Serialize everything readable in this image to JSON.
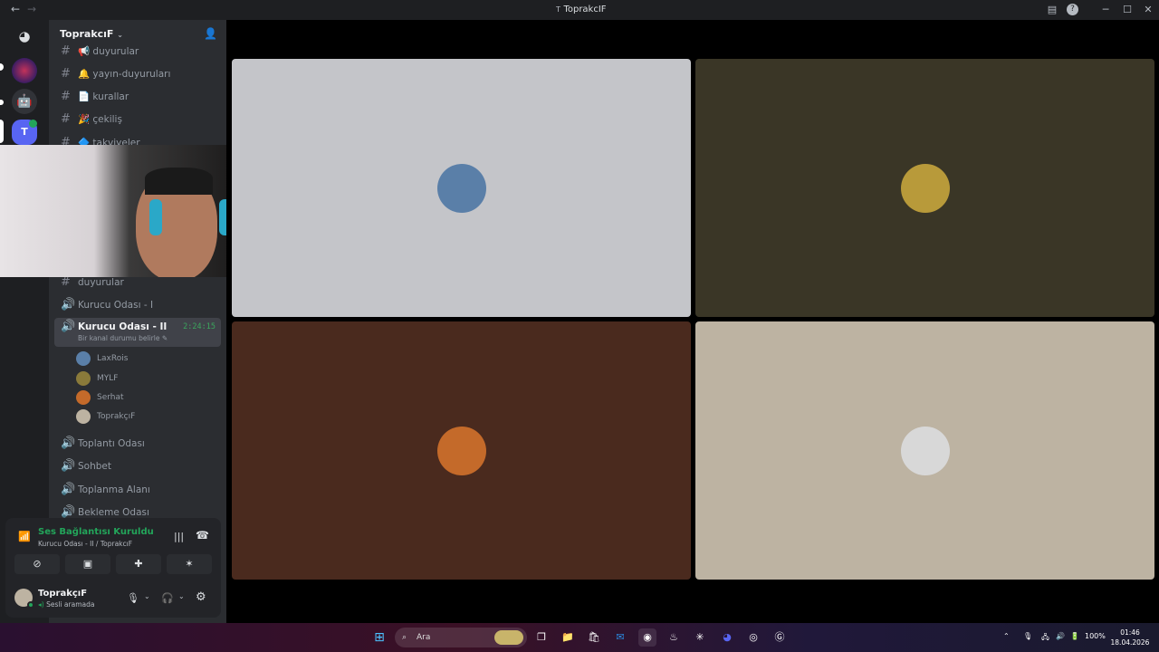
{
  "window": {
    "title": "ToprakcIF",
    "title_icon": "T"
  },
  "server": {
    "name": "ToprakcıF"
  },
  "channels_top": [
    {
      "label": "📢 duyurular"
    },
    {
      "label": "🔔 yayın-duyuruları"
    },
    {
      "label": "📄 kurallar"
    },
    {
      "label": "🎉 çekiliş"
    },
    {
      "label": "🔷 takviyeler"
    }
  ],
  "channels_mid": [
    {
      "label": "duyurular",
      "type": "text"
    },
    {
      "label": "Kurucu Odası - I",
      "type": "voice"
    }
  ],
  "active_channel": {
    "label": "Kurucu Odası - II",
    "timer": "2:24:15",
    "status": "Bir kanal durumu belirle"
  },
  "voice_users": [
    {
      "name": "LaxRois"
    },
    {
      "name": "MYLF"
    },
    {
      "name": "Serhat"
    },
    {
      "name": "ToprakçıF"
    }
  ],
  "channels_bottom": [
    {
      "label": "Toplantı Odası"
    },
    {
      "label": "Sohbet"
    },
    {
      "label": "Toplanma Alanı"
    },
    {
      "label": "Bekleme Odası"
    }
  ],
  "voice_panel": {
    "status": "Ses Bağlantısı Kuruldu",
    "channel": "Kurucu Odası - II / ToprakcıF"
  },
  "user_panel": {
    "name": "ToprakçıF",
    "status": "Sesli aramada"
  },
  "tiles": [
    {
      "bg": "#c4c5c9",
      "avatar": "#5a7fa8"
    },
    {
      "bg": "#3a3626",
      "avatar": "#b89a3a"
    },
    {
      "bg": "#4a2a1e",
      "avatar": "#c46a2a"
    },
    {
      "bg": "#bdb3a2",
      "avatar": "#d8d8d8"
    }
  ],
  "taskbar": {
    "search_placeholder": "Ara",
    "battery": "100%",
    "time": "01:46",
    "date": "18.04.2026"
  },
  "colors": {
    "accent_green": "#23a55a",
    "blurple": "#5865f2"
  }
}
